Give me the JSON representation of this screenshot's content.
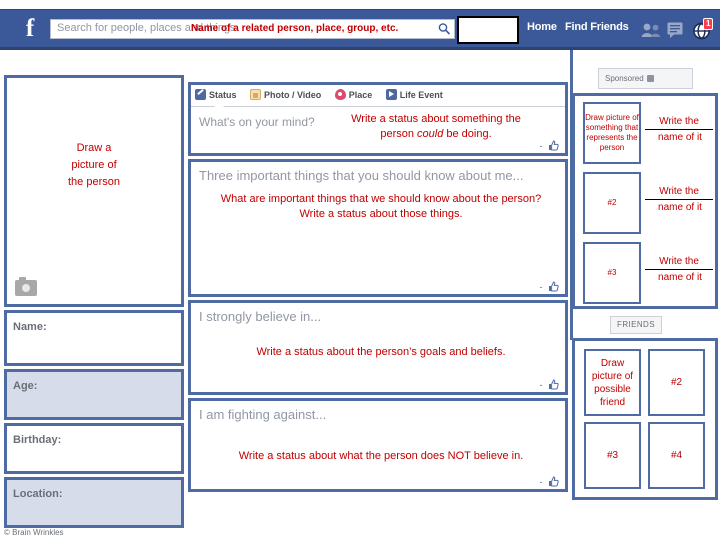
{
  "topbar": {
    "logo": "f",
    "search": {
      "placeholder": "Search for people, places and things",
      "overlay_note": "Name of a related person, place, group, etc.",
      "value": ""
    },
    "name_box_value": "",
    "home_label": "Home",
    "find_friends_label": "Find Friends",
    "notification_count": "1",
    "icons": [
      "friend-requests-icon",
      "messages-icon",
      "notifications-globe-icon"
    ],
    "colors": {
      "bar": "#3b5998",
      "badge": "#fa3c4c"
    }
  },
  "left_column": {
    "photo_hint": "Draw a\npicture of\nthe person",
    "photo_hint_lines": [
      "Draw a",
      "picture of",
      "the person"
    ],
    "camera_icon": "camera-icon",
    "fields": [
      {
        "label": "Name:",
        "value": "",
        "shaded": false
      },
      {
        "label": "Age:",
        "value": "",
        "shaded": true
      },
      {
        "label": "Birthday:",
        "value": "",
        "shaded": false
      },
      {
        "label": "Location:",
        "value": "",
        "shaded": true
      }
    ]
  },
  "composer": {
    "tabs": [
      {
        "label": "Status",
        "icon": "pencil-icon"
      },
      {
        "label": "Photo / Video",
        "icon": "photo-icon"
      },
      {
        "label": "Place",
        "icon": "map-pin-icon"
      },
      {
        "label": "Life Event",
        "icon": "flag-icon"
      }
    ],
    "placeholder": "What's on your mind?",
    "note_line1": "Write a status about something the",
    "note_line2_pre": "person ",
    "note_line2_em": "could",
    "note_line2_post": " be doing.",
    "like_dash": "-",
    "like_icon": "thumbs-up-icon"
  },
  "posts": [
    {
      "placeholder": "Three important things that you should know about me...",
      "note": "What are important things that we should know about the person? Write a status about those things.",
      "like_dash": "-",
      "like_icon": "thumbs-up-icon"
    },
    {
      "placeholder": "I strongly believe in...",
      "note": "Write a status about the person’s goals and beliefs.",
      "like_dash": "-",
      "like_icon": "thumbs-up-icon"
    },
    {
      "placeholder": "I am fighting against...",
      "note": "Write a status about what the person does NOT believe in.",
      "like_dash": "-",
      "like_icon": "thumbs-up-icon"
    }
  ],
  "right_column": {
    "sponsored_label": "Sponsored",
    "sponsored_icon": "sponsored-icon",
    "ads": [
      {
        "thumb_text": "Draw picture of something that represents the person",
        "title_line1": "Write the",
        "title_line2": "name of it"
      },
      {
        "thumb_text": "#2",
        "title_line1": "Write the",
        "title_line2": "name of it"
      },
      {
        "thumb_text": "#3",
        "title_line1": "Write the",
        "title_line2": "name of it"
      }
    ],
    "friends_label": "FRIENDS",
    "friends": [
      {
        "text": "Draw picture of possible friend"
      },
      {
        "text": "#2"
      },
      {
        "text": "#3"
      },
      {
        "text": "#4"
      }
    ]
  },
  "footer": {
    "copyright": "© Brain Wrinkles"
  }
}
